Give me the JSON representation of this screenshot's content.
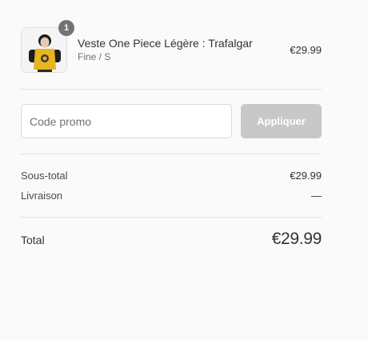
{
  "cart_item": {
    "quantity": "1",
    "name": "Veste One Piece Légère : Trafalgar",
    "variant": "Fine / S",
    "price": "€29.99",
    "image_description": "product-photo"
  },
  "promo": {
    "placeholder": "Code promo",
    "value": "",
    "apply_label": "Appliquer"
  },
  "totals": {
    "subtotal_label": "Sous-total",
    "subtotal_value": "€29.99",
    "shipping_label": "Livraison",
    "shipping_value": "—",
    "total_label": "Total",
    "total_value": "€29.99"
  },
  "colors": {
    "background": "#fafafa",
    "button_disabled": "#c8c8c8",
    "badge": "#737373",
    "divider": "#e1e1e1"
  }
}
